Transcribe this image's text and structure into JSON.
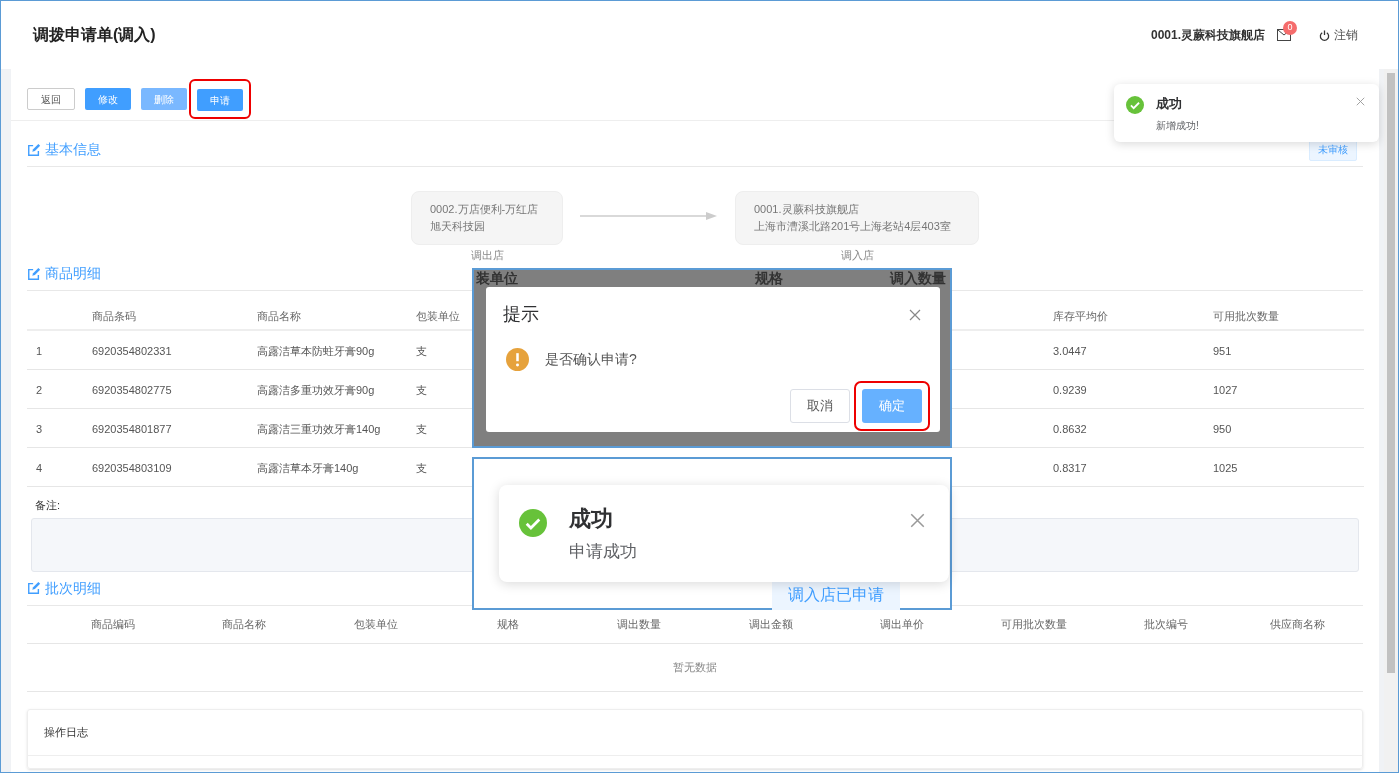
{
  "header": {
    "title": "调拨申请单(调入)",
    "store": "0001.灵蕨科技旗舰店",
    "mail_badge": "0",
    "logout": "注销"
  },
  "toolbar": [
    {
      "label": "返回",
      "kind": "plain",
      "disabled": false,
      "highlighted": false
    },
    {
      "label": "修改",
      "kind": "primary",
      "disabled": false,
      "highlighted": false
    },
    {
      "label": "删除",
      "kind": "primary",
      "disabled": true,
      "highlighted": false
    },
    {
      "label": "申请",
      "kind": "primary",
      "disabled": false,
      "highlighted": true
    }
  ],
  "toast": {
    "title": "成功",
    "message": "新增成功!"
  },
  "basic_info": {
    "heading": "基本信息",
    "status": "未审核",
    "from_store": {
      "line1": "0002.万店便利-万红店",
      "line2": "旭天科技园",
      "caption": "调出店"
    },
    "to_store": {
      "line1": "0001.灵蕨科技旗舰店",
      "line2": "上海市漕溪北路201号上海老站4层403室",
      "caption": "调入店"
    }
  },
  "goods": {
    "heading": "商品明细",
    "columns": [
      "",
      "商品条码",
      "商品名称",
      "包装单位",
      "库存平均价",
      "可用批次数量"
    ],
    "rows": [
      [
        "1",
        "6920354802331",
        "高露洁草本防蛀牙膏90g",
        "支",
        "3.0447",
        "951"
      ],
      [
        "2",
        "6920354802775",
        "高露洁多重功效牙膏90g",
        "支",
        "0.9239",
        "1027"
      ],
      [
        "3",
        "6920354801877",
        "高露洁三重功效牙膏140g",
        "支",
        "0.8632",
        "950"
      ],
      [
        "4",
        "6920354803109",
        "高露洁草本牙膏140g",
        "支",
        "0.8317",
        "1025"
      ]
    ],
    "remark_label": "备注:"
  },
  "batch": {
    "heading": "批次明细",
    "columns": [
      "商品编码",
      "商品名称",
      "包装单位",
      "规格",
      "调出数量",
      "调出金额",
      "调出单价",
      "可用批次数量",
      "批次编号",
      "供应商名称"
    ],
    "empty": "暂无数据"
  },
  "log": {
    "title": "操作日志"
  },
  "dialog_inset": {
    "backdrop_columns": [
      "装单位",
      "规格",
      "调入数量"
    ],
    "title": "提示",
    "message": "是否确认申请?",
    "buttons": [
      {
        "label": "取消",
        "kind": "plain",
        "highlighted": false
      },
      {
        "label": "确定",
        "kind": "primary",
        "highlighted": true
      }
    ]
  },
  "success_inset": {
    "title": "成功",
    "message": "申请成功",
    "status_tag": "调入店已申请"
  }
}
